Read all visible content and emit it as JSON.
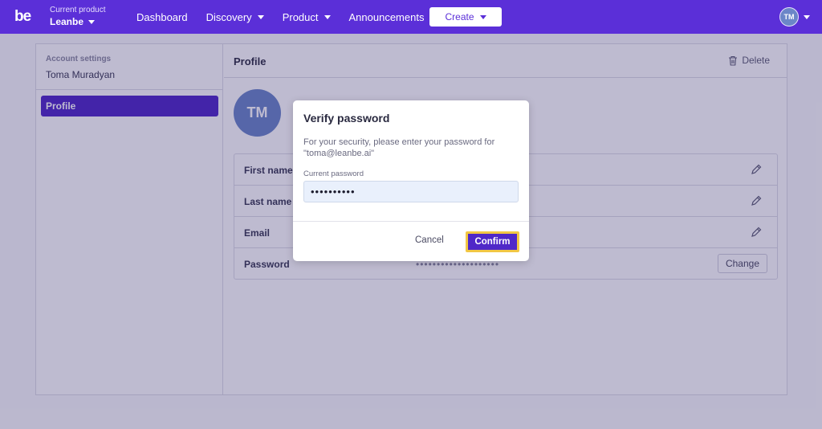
{
  "brand": {
    "logo_text": "be",
    "accent": "#5b2fd8"
  },
  "header": {
    "product_caption": "Current product",
    "product_name": "Leanbe",
    "nav": [
      {
        "label": "Dashboard"
      },
      {
        "label": "Discovery"
      },
      {
        "label": "Product"
      },
      {
        "label": "Announcements"
      }
    ],
    "create_label": "Create",
    "user_initials": "TM"
  },
  "sidebar": {
    "caption": "Account settings",
    "user_name": "Toma Muradyan",
    "items": [
      {
        "label": "Profile",
        "active": true
      }
    ]
  },
  "profile": {
    "title": "Profile",
    "delete_label": "Delete",
    "avatar_initials": "TM",
    "fields": [
      {
        "label": "First name"
      },
      {
        "label": "Last name"
      },
      {
        "label": "Email"
      },
      {
        "label": "Password",
        "value": "••••••••••••••••••••",
        "action": "Change"
      }
    ]
  },
  "dialog": {
    "title": "Verify password",
    "message": "For your security, please enter your password for \"toma@leanbe.ai\"",
    "field_label": "Current password",
    "field_value": "••••••••••",
    "cancel_label": "Cancel",
    "confirm_label": "Confirm",
    "confirm_highlight": "#f2c744"
  }
}
